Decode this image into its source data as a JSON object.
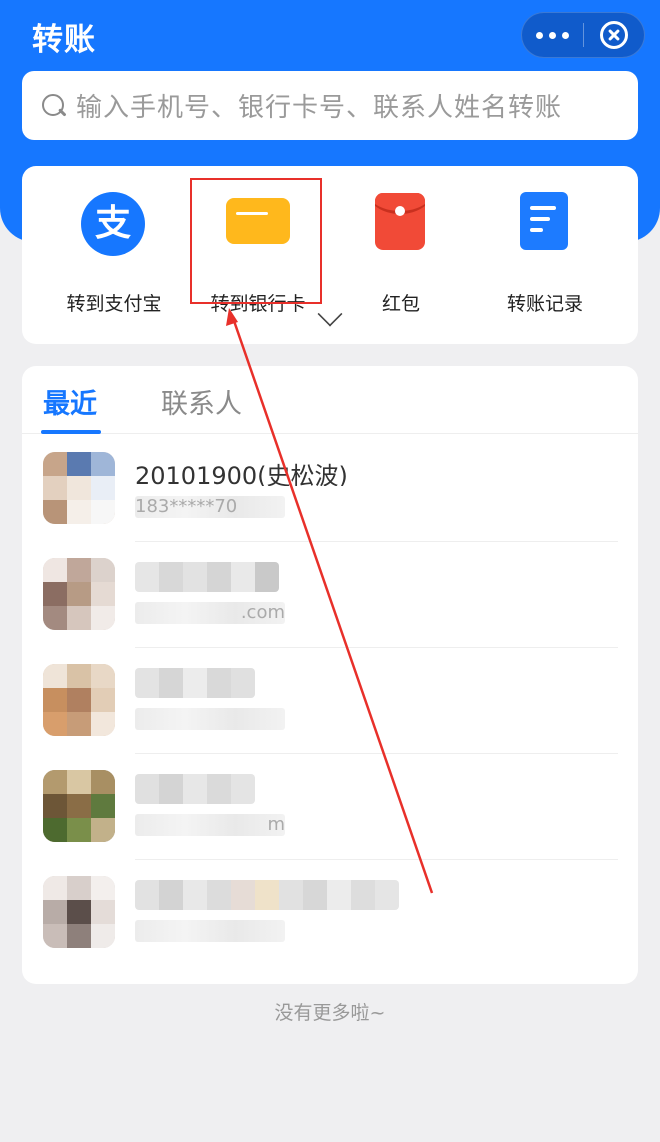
{
  "header": {
    "title": "转账",
    "search_placeholder": "输入手机号、银行卡号、联系人姓名转账"
  },
  "actions": [
    {
      "label": "转到支付宝",
      "icon": "alipay-icon"
    },
    {
      "label": "转到银行卡",
      "icon": "bank-card-icon"
    },
    {
      "label": "红包",
      "icon": "red-packet-icon"
    },
    {
      "label": "转账记录",
      "icon": "transfer-record-icon"
    }
  ],
  "tabs": {
    "recent": "最近",
    "contacts": "联系人"
  },
  "contacts": [
    {
      "name": "20101900(史松波)",
      "sub": "183*****70"
    },
    {
      "name": "",
      "sub": ".com"
    },
    {
      "name": "",
      "sub": ""
    },
    {
      "name": "",
      "sub": "m"
    },
    {
      "name": "",
      "sub": ""
    }
  ],
  "footer": {
    "no_more": "没有更多啦~"
  },
  "colors": {
    "brand_blue": "#1677ff",
    "highlight_red": "#e8302a",
    "card_yellow": "#ffb81c",
    "red_packet": "#f14a37"
  }
}
